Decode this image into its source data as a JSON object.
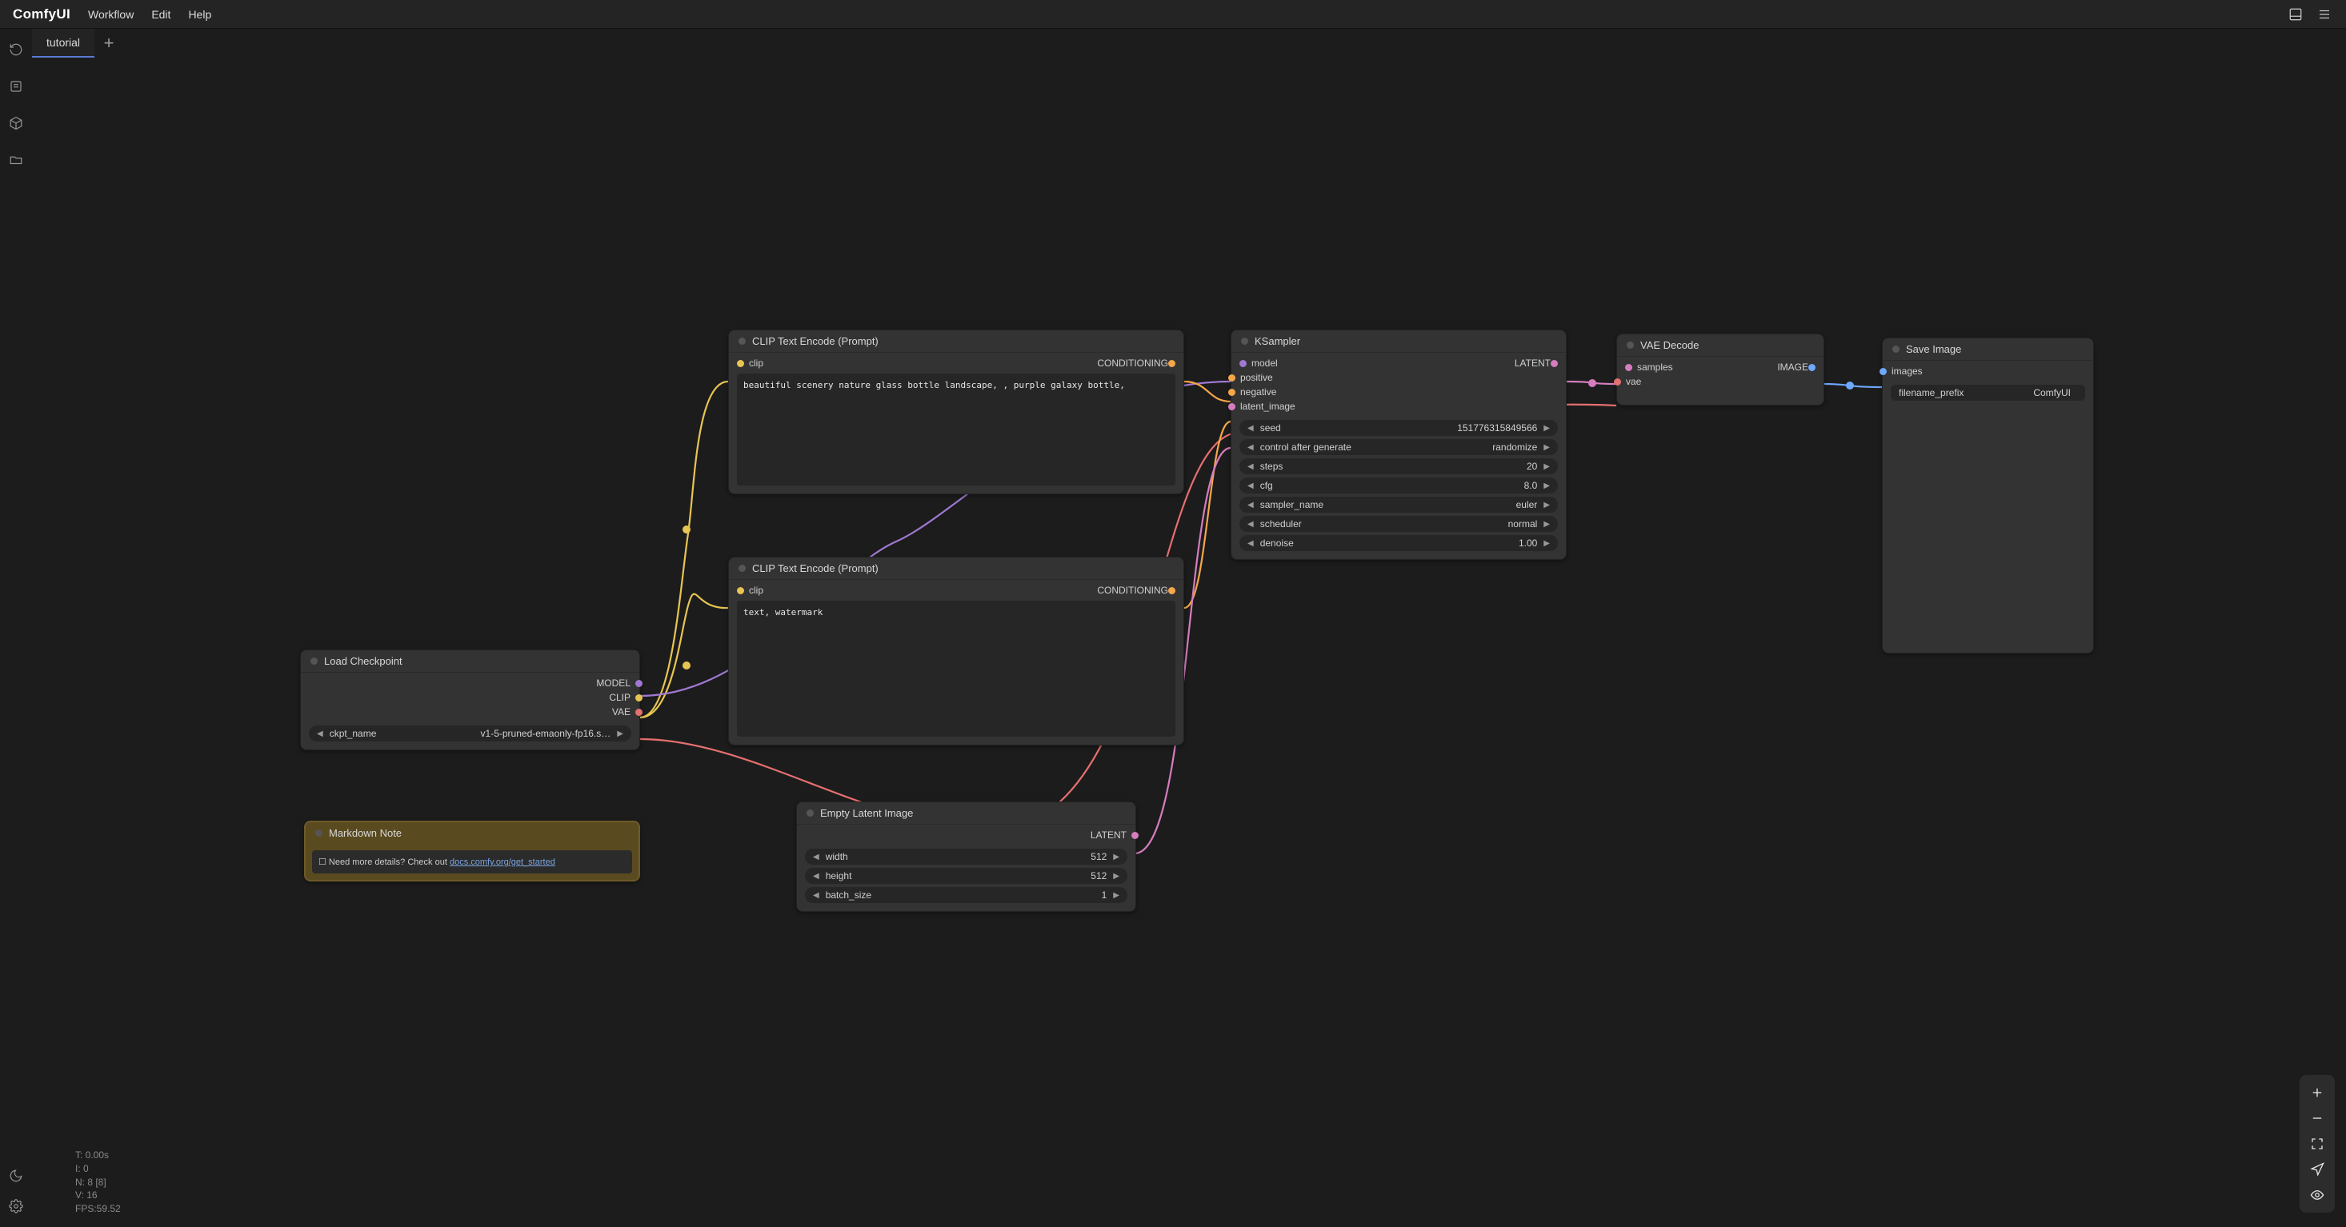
{
  "app": {
    "logo": "ComfyUI"
  },
  "menu": {
    "workflow": "Workflow",
    "edit": "Edit",
    "help": "Help"
  },
  "tabs": {
    "active": "tutorial"
  },
  "nodes": {
    "load_checkpoint": {
      "title": "Load Checkpoint",
      "outputs": {
        "model": "MODEL",
        "clip": "CLIP",
        "vae": "VAE"
      },
      "widgets": {
        "ckpt_label": "ckpt_name",
        "ckpt_value": "v1-5-pruned-emaonly-fp16.s…"
      }
    },
    "clip_pos": {
      "title": "CLIP Text Encode (Prompt)",
      "in_clip": "clip",
      "out_cond": "CONDITIONING",
      "text": "beautiful scenery nature glass bottle landscape, , purple galaxy bottle,"
    },
    "clip_neg": {
      "title": "CLIP Text Encode (Prompt)",
      "in_clip": "clip",
      "out_cond": "CONDITIONING",
      "text": "text, watermark"
    },
    "empty_latent": {
      "title": "Empty Latent Image",
      "out_latent": "LATENT",
      "widgets": {
        "width_label": "width",
        "width_value": "512",
        "height_label": "height",
        "height_value": "512",
        "batch_label": "batch_size",
        "batch_value": "1"
      }
    },
    "ksampler": {
      "title": "KSampler",
      "inputs": {
        "model": "model",
        "positive": "positive",
        "negative": "negative",
        "latent_image": "latent_image"
      },
      "outputs": {
        "latent": "LATENT"
      },
      "widgets": {
        "seed_label": "seed",
        "seed_value": "151776315849566",
        "ctrl_label": "control after generate",
        "ctrl_value": "randomize",
        "steps_label": "steps",
        "steps_value": "20",
        "cfg_label": "cfg",
        "cfg_value": "8.0",
        "sampler_label": "sampler_name",
        "sampler_value": "euler",
        "scheduler_label": "scheduler",
        "scheduler_value": "normal",
        "denoise_label": "denoise",
        "denoise_value": "1.00"
      }
    },
    "vae_decode": {
      "title": "VAE Decode",
      "inputs": {
        "samples": "samples",
        "vae": "vae"
      },
      "outputs": {
        "image": "IMAGE"
      }
    },
    "save_image": {
      "title": "Save Image",
      "inputs": {
        "images": "images"
      },
      "widgets": {
        "prefix_label": "filename_prefix",
        "prefix_value": "ComfyUI"
      }
    },
    "markdown": {
      "title": "Markdown Note",
      "text_prefix": "☐ Need more details? Check out ",
      "link_text": "docs.comfy.org/get_started"
    }
  },
  "stats": {
    "t": "T: 0.00s",
    "i": "I: 0",
    "n": "N: 8 [8]",
    "v": "V: 16",
    "fps": "FPS:59.52"
  }
}
